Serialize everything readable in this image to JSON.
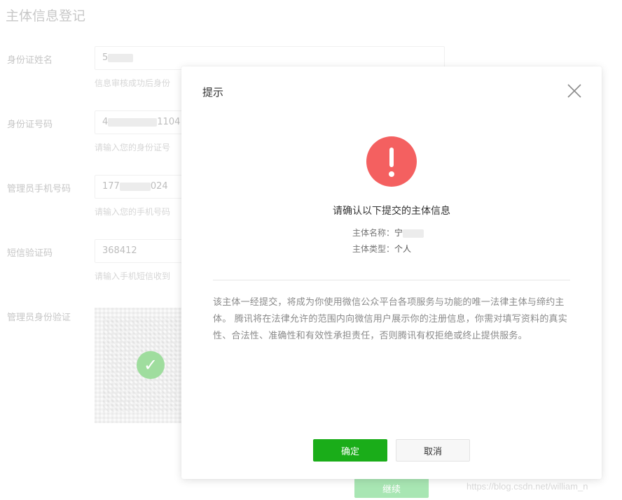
{
  "page": {
    "title": "主体信息登记",
    "fields": [
      {
        "label": "身份证姓名",
        "value_prefix": "5",
        "hint": "信息审核成功后身份"
      },
      {
        "label": "身份证号码",
        "value_prefix": "4",
        "value_suffix": "1104",
        "hint": "请输入您的身份证号"
      },
      {
        "label": "管理员手机号码",
        "value_prefix": "177",
        "value_suffix": "024",
        "hint": "请输入您的手机号码"
      },
      {
        "label": "短信验证码",
        "value": "368412",
        "hint": "请输入手机短信收到"
      },
      {
        "label": "管理员身份验证"
      }
    ],
    "continue_label": "继续",
    "watermark": "https://blog.csdn.net/william_n"
  },
  "modal": {
    "title": "提示",
    "heading": "请确认以下提交的主体信息",
    "entity_name_label": "主体名称：",
    "entity_name_value": "宁",
    "entity_type_label": "主体类型：",
    "entity_type_value": "个人",
    "notice": "该主体一经提交，将成为你使用微信公众平台各项服务与功能的唯一法律主体与缔约主体。 腾讯将在法律允许的范围内向微信用户展示你的注册信息，你需对填写资料的真实性、合法性、准确性和有效性承担责任，否则腾讯有权拒绝或终止提供服务。",
    "confirm_label": "确定",
    "cancel_label": "取消"
  },
  "colors": {
    "primary_green": "#1aad19",
    "alert_red": "#f46060",
    "disabled_green": "#a8e6b3"
  },
  "icons": {
    "close": "close-icon",
    "alert": "exclamation-icon",
    "check": "check-icon"
  }
}
